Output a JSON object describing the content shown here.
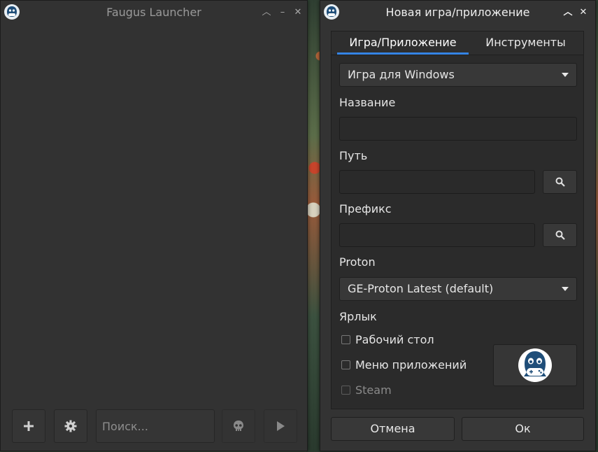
{
  "launcher": {
    "title": "Faugus Launcher",
    "search_placeholder": "Поиск...",
    "icons": {
      "add": "plus-icon",
      "settings": "gear-icon",
      "kill": "skull-icon",
      "play": "play-icon"
    }
  },
  "dialog": {
    "title": "Новая игра/приложение",
    "tabs": [
      {
        "label": "Игра/Приложение",
        "active": true
      },
      {
        "label": "Инструменты",
        "active": false
      }
    ],
    "game_type": "Игра для Windows",
    "name_label": "Название",
    "name_value": "",
    "path_label": "Путь",
    "path_value": "",
    "prefix_label": "Префикс",
    "prefix_value": "",
    "proton_label": "Proton",
    "proton_value": "GE-Proton Latest (default)",
    "shortcut_label": "Ярлык",
    "shortcuts": [
      {
        "label": "Рабочий стол",
        "checked": false,
        "enabled": true
      },
      {
        "label": "Меню приложений",
        "checked": false,
        "enabled": true
      },
      {
        "label": "Steam",
        "checked": false,
        "enabled": false
      }
    ],
    "cancel_label": "Отмена",
    "ok_label": "Ок"
  },
  "colors": {
    "accent": "#3584e4",
    "window_bg": "#2f2f2f",
    "logo_blue": "#1f4e79"
  }
}
